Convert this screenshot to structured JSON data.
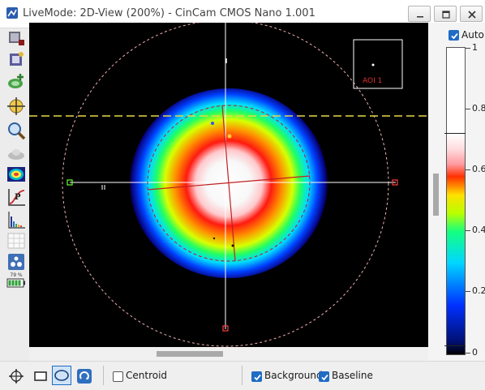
{
  "window": {
    "title": "LiveMode: 2D-View (200%) - CinCam CMOS Nano 1.001"
  },
  "colors": {
    "accent": "#1f6cc4",
    "crosshair": "#ffffff",
    "level_line": "#e8d84a",
    "ellipse": "#d03030"
  },
  "roi": {
    "label": "AOI 1"
  },
  "colorbar": {
    "auto_label": "Auto",
    "auto_checked": true,
    "ticks": [
      "1",
      "0.8",
      "0.6",
      "0.4",
      "0.2",
      "0"
    ]
  },
  "toolbar": {
    "icons": [
      "camera-icon",
      "snapshot-icon",
      "beam-add-icon",
      "crosshair-move-icon",
      "zoom-icon",
      "cloud-icon",
      "beam-profile-icon",
      "power-icon",
      "histogram-icon",
      "grid-icon",
      "camera-settings-icon",
      "battery-icon"
    ],
    "battery_label": "79 %"
  },
  "bottom": {
    "centroid_label": "Centroid",
    "centroid_checked": false,
    "background_label": "Background",
    "background_checked": true,
    "baseline_label": "Baseline",
    "baseline_checked": true
  }
}
